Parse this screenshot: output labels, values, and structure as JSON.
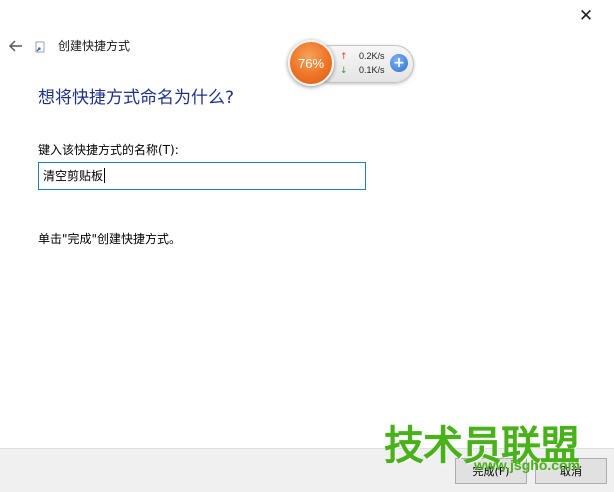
{
  "window": {
    "title": "创建快捷方式",
    "close_glyph": "✕",
    "back_icon": "arrow-left-icon"
  },
  "main": {
    "heading": "想将快捷方式命名为什么?",
    "name_label": "键入该快捷方式的名称(T):",
    "name_value": "清空剪贴板",
    "hint": "单击\"完成\"创建快捷方式。"
  },
  "footer": {
    "finish_label": "完成(F)",
    "cancel_label": "取消"
  },
  "speed_widget": {
    "percent": "76%",
    "upload": "0.2K/s",
    "download": "0.1K/s",
    "up_arrow": "↑",
    "down_arrow": "↓",
    "plus": "+"
  },
  "watermark": {
    "title": "技术员联盟",
    "url": "www.jsgho.com"
  },
  "colors": {
    "heading": "#1e3287",
    "input_border": "#1f7fbf",
    "widget_orange": "#ee7325",
    "watermark_green": "#49b21a"
  }
}
